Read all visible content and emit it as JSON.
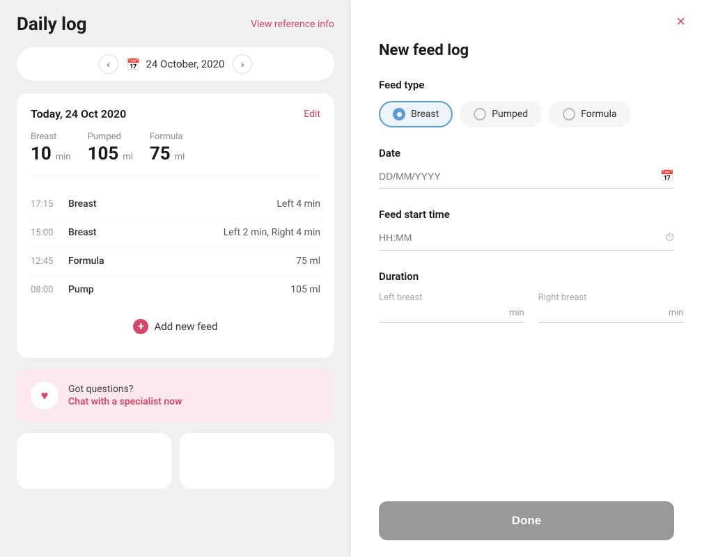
{
  "left": {
    "title": "Daily log",
    "view_ref": "View reference info",
    "date": "24 October, 2020",
    "card": {
      "date_label": "Today, 24 Oct 2020",
      "edit_label": "Edit",
      "summary": [
        {
          "label": "Breast",
          "value": "10",
          "unit": "min"
        },
        {
          "label": "Pumped",
          "value": "105",
          "unit": "ml"
        },
        {
          "label": "Formula",
          "value": "75",
          "unit": "ml"
        }
      ],
      "feeds": [
        {
          "time": "17:15",
          "type": "Breast",
          "detail": "Left 4 min"
        },
        {
          "time": "15:00",
          "type": "Breast",
          "detail": "Left 2 min, Right 4 min"
        },
        {
          "time": "12:45",
          "type": "Formula",
          "detail": "75 ml"
        },
        {
          "time": "08:00",
          "type": "Pump",
          "detail": "105 ml"
        }
      ],
      "add_label": "Add new feed"
    },
    "chat": {
      "question": "Got questions?",
      "link": "Chat with a specialist now"
    }
  },
  "right": {
    "close_label": "×",
    "title": "New feed log",
    "feed_type_label": "Feed type",
    "feed_types": [
      {
        "label": "Breast",
        "selected": true
      },
      {
        "label": "Pumped",
        "selected": false
      },
      {
        "label": "Formula",
        "selected": false
      }
    ],
    "date_label": "Date",
    "date_placeholder": "DD/MM/YYYY",
    "time_label": "Feed start time",
    "time_placeholder": "HH:MM",
    "duration_label": "Duration",
    "left_breast_label": "Left breast",
    "right_breast_label": "Right breast",
    "min_unit": "min",
    "done_label": "Done"
  }
}
